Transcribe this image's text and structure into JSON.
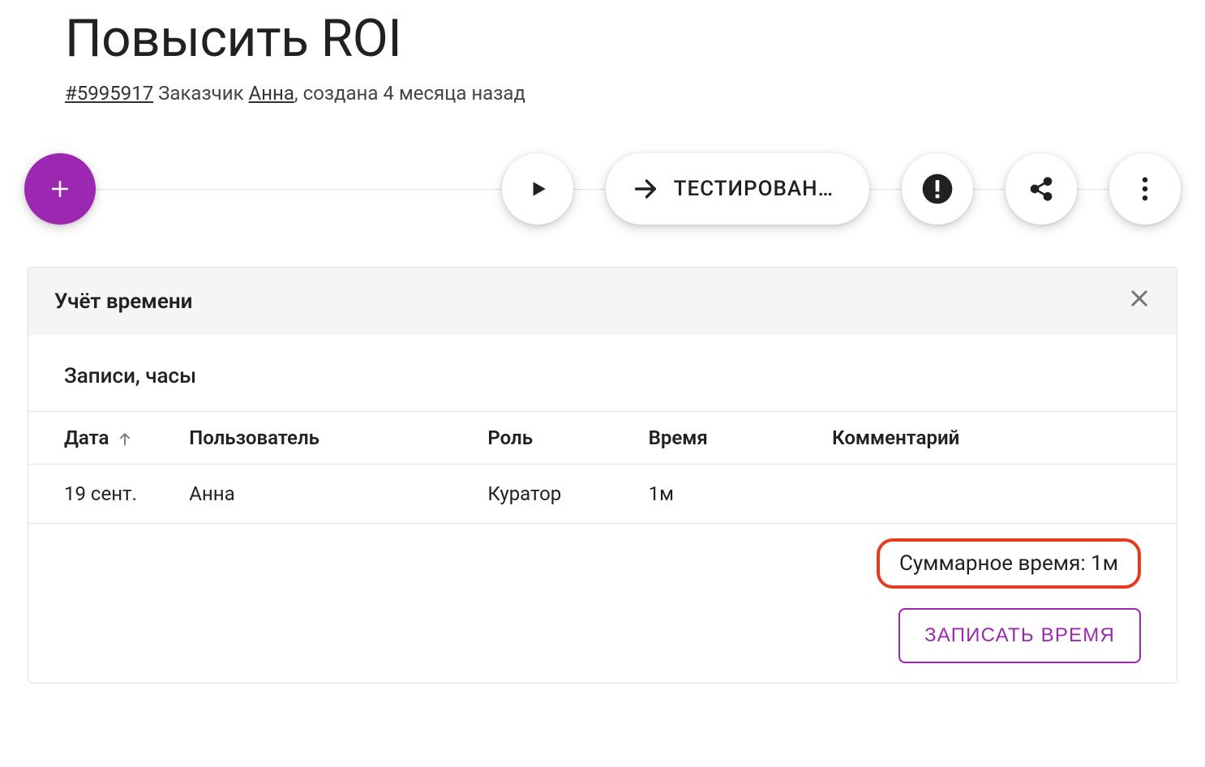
{
  "header": {
    "title": "Повысить ROI",
    "task_id": "#5995917",
    "customer_prefix": " Заказчик ",
    "customer_name": "Анна",
    "created_text": ", создана 4 месяца назад"
  },
  "actions": {
    "status_label": "ТЕСТИРОВАН…"
  },
  "panel": {
    "title": "Учёт времени",
    "section_label": "Записи, часы",
    "columns": {
      "date": "Дата",
      "user": "Пользователь",
      "role": "Роль",
      "time": "Время",
      "comment": "Комментарий"
    },
    "rows": [
      {
        "date": "19 сент.",
        "user": "Анна",
        "role": "Куратор",
        "time": "1м",
        "comment": ""
      }
    ],
    "summary_label": "Суммарное время: ",
    "summary_value": "1м",
    "action_button": "ЗАПИСАТЬ ВРЕМЯ"
  }
}
